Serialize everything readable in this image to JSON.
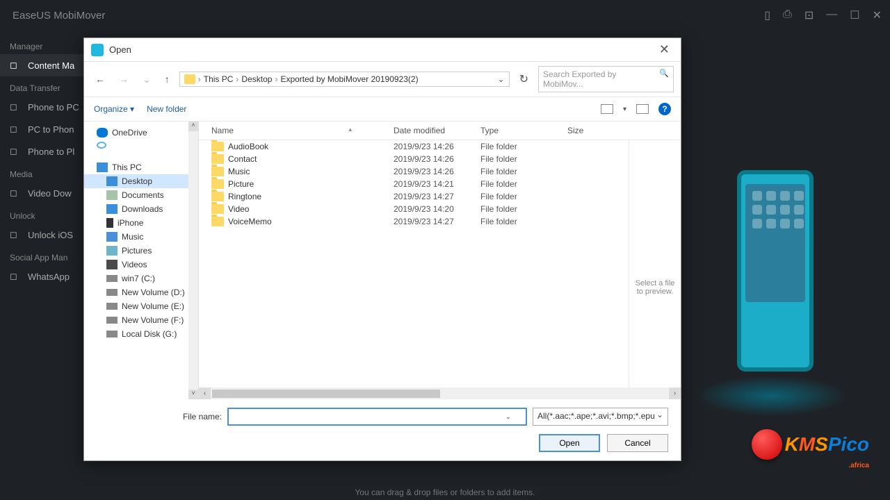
{
  "app": {
    "title": "EaseUS MobiMover",
    "dragHint": "You can drag & drop files or folders to add items."
  },
  "sidebarBg": {
    "sections": [
      {
        "label": "Manager",
        "items": [
          {
            "label": "Content Ma",
            "active": true
          }
        ]
      },
      {
        "label": "Data Transfer",
        "items": [
          {
            "label": "Phone to PC"
          },
          {
            "label": "PC to Phon"
          },
          {
            "label": "Phone to Pl"
          }
        ]
      },
      {
        "label": "Media",
        "items": [
          {
            "label": "Video Dow"
          }
        ]
      },
      {
        "label": "Unlock",
        "items": [
          {
            "label": "Unlock iOS"
          }
        ]
      },
      {
        "label": "Social App Man",
        "items": [
          {
            "label": "WhatsApp"
          }
        ]
      }
    ]
  },
  "dialog": {
    "title": "Open",
    "breadcrumb": [
      "This PC",
      "Desktop",
      "Exported by MobiMover 20190923(2)"
    ],
    "searchPlaceholder": "Search Exported by MobiMov...",
    "toolbar": {
      "organize": "Organize",
      "newFolder": "New folder"
    },
    "columns": {
      "name": "Name",
      "date": "Date modified",
      "type": "Type",
      "size": "Size"
    },
    "tree": [
      {
        "label": "OneDrive",
        "ico": "ico-onedrive"
      },
      {
        "label": "",
        "ico": "ico-cloud"
      },
      {
        "label": "This PC",
        "ico": "ico-pc"
      },
      {
        "label": "Desktop",
        "ico": "ico-desktop",
        "sub": true,
        "selected": true
      },
      {
        "label": "Documents",
        "ico": "ico-doc",
        "sub": true
      },
      {
        "label": "Downloads",
        "ico": "ico-down",
        "sub": true
      },
      {
        "label": "iPhone",
        "ico": "ico-phone",
        "sub": true
      },
      {
        "label": "Music",
        "ico": "ico-music",
        "sub": true
      },
      {
        "label": "Pictures",
        "ico": "ico-pic",
        "sub": true
      },
      {
        "label": "Videos",
        "ico": "ico-vid",
        "sub": true
      },
      {
        "label": "win7 (C:)",
        "ico": "ico-drive",
        "sub": true
      },
      {
        "label": "New Volume (D:)",
        "ico": "ico-drive",
        "sub": true
      },
      {
        "label": "New Volume (E:)",
        "ico": "ico-drive",
        "sub": true
      },
      {
        "label": "New Volume (F:)",
        "ico": "ico-drive",
        "sub": true
      },
      {
        "label": "Local Disk (G:)",
        "ico": "ico-drive",
        "sub": true
      }
    ],
    "files": [
      {
        "name": "AudioBook",
        "date": "2019/9/23 14:26",
        "type": "File folder"
      },
      {
        "name": "Contact",
        "date": "2019/9/23 14:26",
        "type": "File folder"
      },
      {
        "name": "Music",
        "date": "2019/9/23 14:26",
        "type": "File folder"
      },
      {
        "name": "Picture",
        "date": "2019/9/23 14:21",
        "type": "File folder"
      },
      {
        "name": "Ringtone",
        "date": "2019/9/23 14:27",
        "type": "File folder"
      },
      {
        "name": "Video",
        "date": "2019/9/23 14:20",
        "type": "File folder"
      },
      {
        "name": "VoiceMemo",
        "date": "2019/9/23 14:27",
        "type": "File folder"
      }
    ],
    "previewHint": "Select a file to preview.",
    "fileNameLabel": "File name:",
    "fileNameValue": "",
    "filterValue": "All(*.aac;*.ape;*.avi;*.bmp;*.epu",
    "openBtn": "Open",
    "cancelBtn": "Cancel"
  },
  "logo": {
    "text": "KMSPico",
    "sub": ".africa"
  }
}
